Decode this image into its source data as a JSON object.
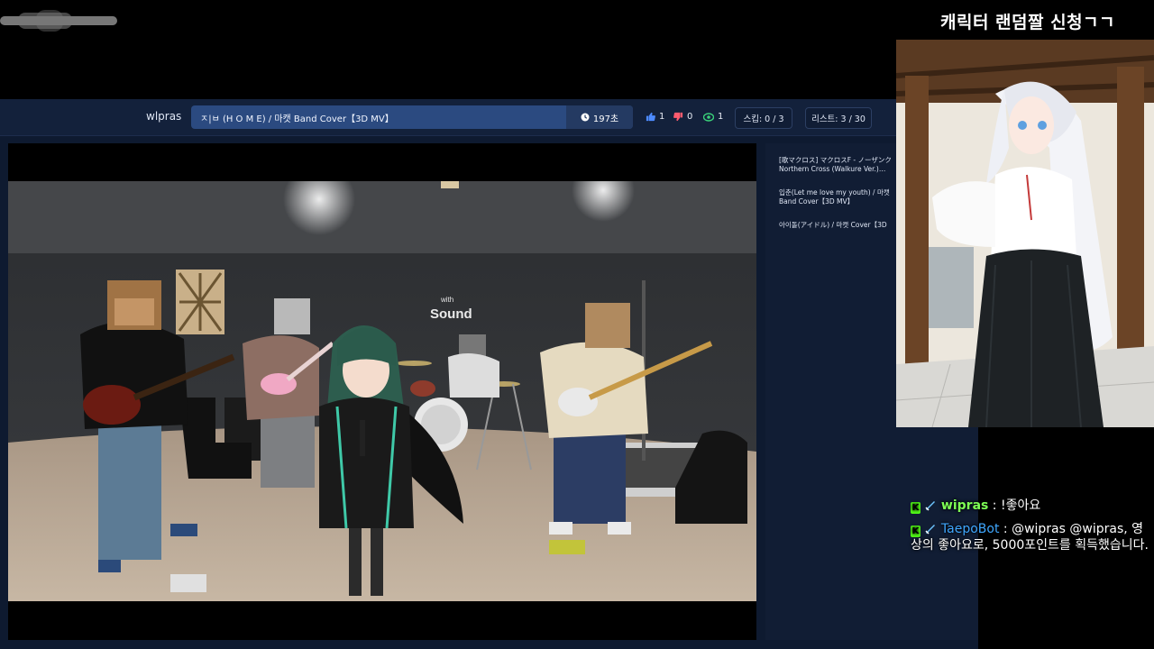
{
  "overlay": {
    "title": "캐릭터 랜덤짤 신청ㄱㄱ"
  },
  "toolbar": {
    "user": "wlpras",
    "song": "ㅈ|ㅂ (H O M E) / 마캣 Band Cover【3D MV】",
    "time": "197초",
    "likes": "1",
    "dislikes": "0",
    "views": "1",
    "skip": "스킵: 0 / 3",
    "list": "리스트: 3 / 30"
  },
  "queue": [
    {
      "line1": "[歌マクロス] マクロスF - ノーザンク",
      "line2": "Northern Cross (Walkure Ver.)…"
    },
    {
      "line1": "입춘(Let me love my youth) / 마캣",
      "line2": "Band Cover【3D MV】"
    },
    {
      "line1": "아이돌(アイドル) / 마캣 Cover【3D",
      "line2": ""
    }
  ],
  "video": {
    "wall_sign_small": "with",
    "wall_sign": "Sound"
  },
  "chat": [
    {
      "nick": "wipras",
      "sep": " : ",
      "text": "!좋아요"
    },
    {
      "nick": "TaepoBot",
      "sep": " : ",
      "text": "@wipras @wipras, 영상의 좋아요로, 5000포인트를 획득했습니다."
    }
  ],
  "colors": {
    "accent": "#2b4a80",
    "like": "#4d8bff",
    "dislike": "#ff5b6e",
    "views": "#3ad17a",
    "kick": "#53fc18"
  }
}
